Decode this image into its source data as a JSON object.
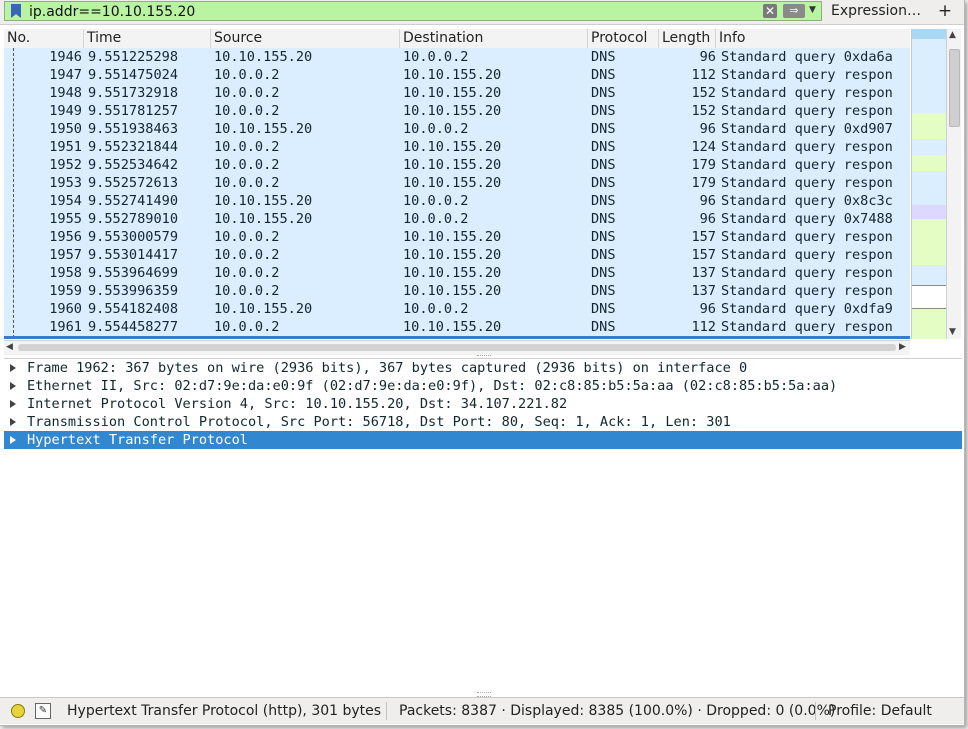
{
  "filter": {
    "value": "ip.addr==10.10.155.20",
    "clear_icon": "✕",
    "apply_icon": "⇒",
    "expression_label": "Expression…",
    "add_label": "+"
  },
  "columns": {
    "no": "No.",
    "time": "Time",
    "source": "Source",
    "destination": "Destination",
    "protocol": "Protocol",
    "length": "Length",
    "info": "Info"
  },
  "packets": [
    {
      "no": "1946",
      "time": "9.551225298",
      "src": "10.10.155.20",
      "dst": "10.0.0.2",
      "proto": "DNS",
      "len": "96",
      "info": "Standard query 0xda6a"
    },
    {
      "no": "1947",
      "time": "9.551475024",
      "src": "10.0.0.2",
      "dst": "10.10.155.20",
      "proto": "DNS",
      "len": "112",
      "info": "Standard query respon"
    },
    {
      "no": "1948",
      "time": "9.551732918",
      "src": "10.0.0.2",
      "dst": "10.10.155.20",
      "proto": "DNS",
      "len": "152",
      "info": "Standard query respon"
    },
    {
      "no": "1949",
      "time": "9.551781257",
      "src": "10.0.0.2",
      "dst": "10.10.155.20",
      "proto": "DNS",
      "len": "152",
      "info": "Standard query respon"
    },
    {
      "no": "1950",
      "time": "9.551938463",
      "src": "10.10.155.20",
      "dst": "10.0.0.2",
      "proto": "DNS",
      "len": "96",
      "info": "Standard query 0xd907"
    },
    {
      "no": "1951",
      "time": "9.552321844",
      "src": "10.0.0.2",
      "dst": "10.10.155.20",
      "proto": "DNS",
      "len": "124",
      "info": "Standard query respon"
    },
    {
      "no": "1952",
      "time": "9.552534642",
      "src": "10.0.0.2",
      "dst": "10.10.155.20",
      "proto": "DNS",
      "len": "179",
      "info": "Standard query respon"
    },
    {
      "no": "1953",
      "time": "9.552572613",
      "src": "10.0.0.2",
      "dst": "10.10.155.20",
      "proto": "DNS",
      "len": "179",
      "info": "Standard query respon"
    },
    {
      "no": "1954",
      "time": "9.552741490",
      "src": "10.10.155.20",
      "dst": "10.0.0.2",
      "proto": "DNS",
      "len": "96",
      "info": "Standard query 0x8c3c"
    },
    {
      "no": "1955",
      "time": "9.552789010",
      "src": "10.10.155.20",
      "dst": "10.0.0.2",
      "proto": "DNS",
      "len": "96",
      "info": "Standard query 0x7488"
    },
    {
      "no": "1956",
      "time": "9.553000579",
      "src": "10.0.0.2",
      "dst": "10.10.155.20",
      "proto": "DNS",
      "len": "157",
      "info": "Standard query respon"
    },
    {
      "no": "1957",
      "time": "9.553014417",
      "src": "10.0.0.2",
      "dst": "10.10.155.20",
      "proto": "DNS",
      "len": "157",
      "info": "Standard query respon"
    },
    {
      "no": "1958",
      "time": "9.553964699",
      "src": "10.0.0.2",
      "dst": "10.10.155.20",
      "proto": "DNS",
      "len": "137",
      "info": "Standard query respon"
    },
    {
      "no": "1959",
      "time": "9.553996359",
      "src": "10.0.0.2",
      "dst": "10.10.155.20",
      "proto": "DNS",
      "len": "137",
      "info": "Standard query respon"
    },
    {
      "no": "1960",
      "time": "9.554182408",
      "src": "10.10.155.20",
      "dst": "10.0.0.2",
      "proto": "DNS",
      "len": "96",
      "info": "Standard query 0xdfa9"
    },
    {
      "no": "1961",
      "time": "9.554458277",
      "src": "10.0.0.2",
      "dst": "10.10.155.20",
      "proto": "DNS",
      "len": "112",
      "info": "Standard query respon"
    }
  ],
  "details": [
    {
      "text": "Frame 1962: 367 bytes on wire (2936 bits), 367 bytes captured (2936 bits) on interface 0",
      "selected": false
    },
    {
      "text": "Ethernet II, Src: 02:d7:9e:da:e0:9f (02:d7:9e:da:e0:9f), Dst: 02:c8:85:b5:5a:aa (02:c8:85:b5:5a:aa)",
      "selected": false
    },
    {
      "text": "Internet Protocol Version 4, Src: 10.10.155.20, Dst: 34.107.221.82",
      "selected": false
    },
    {
      "text": "Transmission Control Protocol, Src Port: 56718, Dst Port: 80, Seq: 1, Ack: 1, Len: 301",
      "selected": false
    },
    {
      "text": "Hypertext Transfer Protocol",
      "selected": true
    }
  ],
  "status": {
    "selected_field": "Hypertext Transfer Protocol (http), 301 bytes",
    "packets": "Packets: 8387 · Displayed: 8385 (100.0%) · Dropped: 0 (0.0%)",
    "profile": "Profile: Default"
  },
  "colors": {
    "filter_valid": "#b9f4a2",
    "dns_row": "#daeeff",
    "selection": "#3188d0"
  }
}
